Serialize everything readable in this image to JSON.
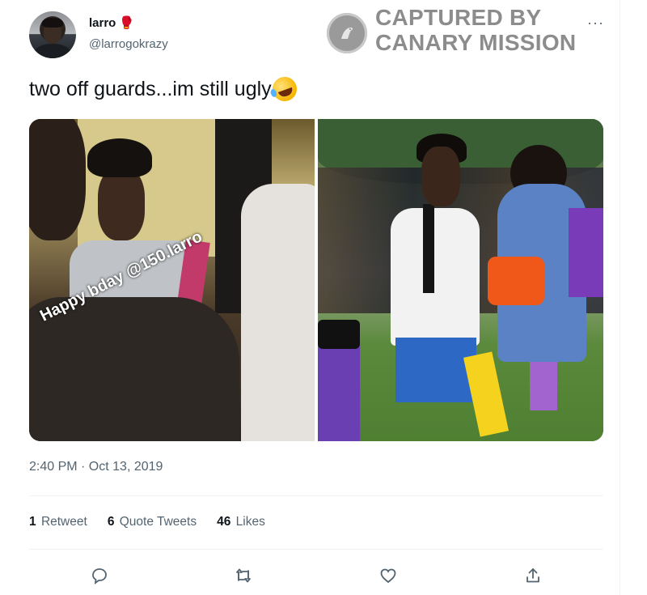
{
  "author": {
    "display_name": "larro",
    "badge_icon": "boxing-glove-icon",
    "handle": "@larrogokrazy"
  },
  "header": {
    "more_icon": "more-icon"
  },
  "watermark": {
    "line1": "CAPTURED BY",
    "line2": "CANARY MISSION",
    "logo_icon": "canary-bird-icon"
  },
  "tweet": {
    "text": "two off guards...im still ugly",
    "emoji_icon": "rolling-on-floor-laughing-emoji",
    "photo_caption": "Happy bday @150.larro",
    "timestamp": "2:40 PM · Oct 13, 2019"
  },
  "stats": {
    "retweets_count": "1",
    "retweets_label": "Retweet",
    "quotes_count": "6",
    "quotes_label": "Quote Tweets",
    "likes_count": "46",
    "likes_label": "Likes"
  },
  "actions": [
    "reply-icon",
    "retweet-icon",
    "like-icon",
    "share-icon"
  ],
  "colors": {
    "text": "#0f1419",
    "muted": "#536471",
    "divider": "#eff3f4"
  }
}
